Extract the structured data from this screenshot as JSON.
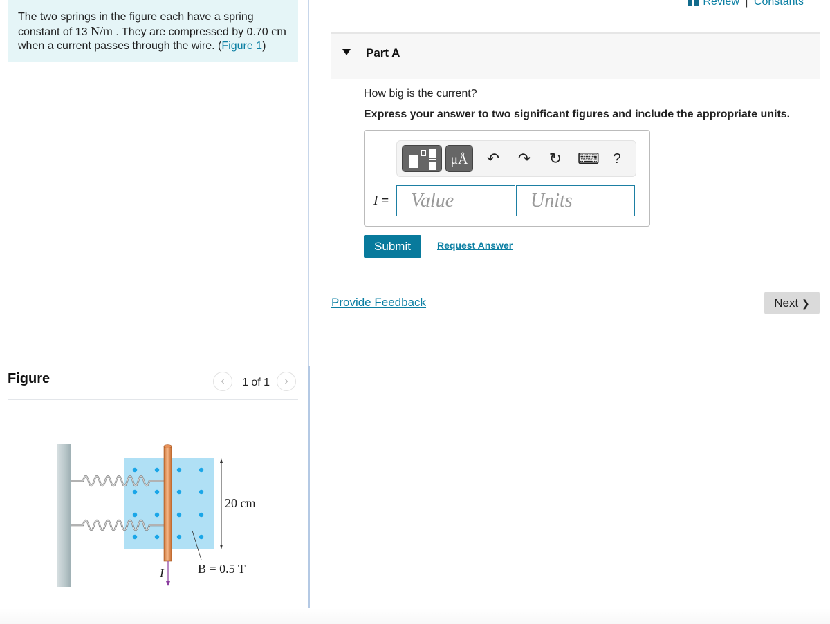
{
  "problem": {
    "text_1": "The two springs in the figure each have a spring constant of 13 ",
    "spring_constant_unit": "N/m",
    "text_2": " . They are compressed by 0.70 ",
    "compression_unit": "cm",
    "text_3": " when a current passes through the wire. (",
    "figure_link": "Figure 1",
    "text_4": ")"
  },
  "figure_panel": {
    "title": "Figure",
    "pager": "1 of 1",
    "prev_icon": "chevron-left-icon",
    "next_icon": "chevron-right-icon",
    "diagram": {
      "length_label": "20 cm",
      "field_label": "B = 0.5 T",
      "current_label": "I",
      "field_color": "#b0e0f5",
      "dot_color": "#1aa6e8",
      "wire_color": "#f0a36a",
      "arrow_color": "#8a3c9e"
    }
  },
  "top_links": {
    "review": "Review",
    "separator": "|",
    "constants": "Constants"
  },
  "part": {
    "title": "Part A",
    "question": "How big is the current?",
    "instruction": "Express your answer to two significant figures and include the appropriate units."
  },
  "toolbar": {
    "templates_icon": "templates-icon",
    "units_label": "μÅ",
    "undo_icon": "↶",
    "redo_icon": "↷",
    "reset_icon": "↻",
    "keyboard_icon": "⌨",
    "help_label": "?"
  },
  "answer": {
    "variable": "I",
    "equals": " =",
    "value_placeholder": "Value",
    "value": "",
    "units_placeholder": "Units",
    "units": ""
  },
  "actions": {
    "submit": "Submit",
    "request_answer": "Request Answer",
    "provide_feedback": "Provide Feedback",
    "next": "Next",
    "next_chevron": "❯"
  },
  "colors": {
    "accent": "#087a9c",
    "link": "#0b7fa3",
    "problem_bg": "#e5f5f7"
  }
}
